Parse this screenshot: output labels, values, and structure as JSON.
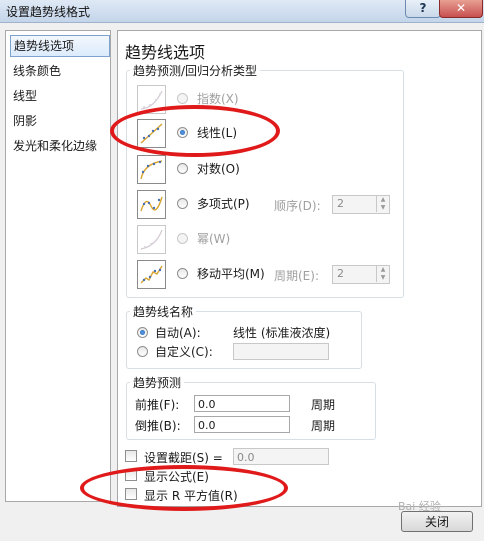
{
  "window": {
    "title": "设置趋势线格式",
    "help_glyph": "?",
    "close_glyph": "✕"
  },
  "nav": {
    "items": [
      {
        "label": "趋势线选项"
      },
      {
        "label": "线条颜色"
      },
      {
        "label": "线型"
      },
      {
        "label": "阴影"
      },
      {
        "label": "发光和柔化边缘"
      }
    ]
  },
  "main": {
    "heading": "趋势线选项",
    "trend_group": {
      "legend": "趋势预测/回归分析类型",
      "options": [
        {
          "label": "指数(X)",
          "enabled": false,
          "selected": false,
          "icon": "exponential-icon"
        },
        {
          "label": "线性(L)",
          "enabled": true,
          "selected": true,
          "icon": "linear-icon"
        },
        {
          "label": "对数(O)",
          "enabled": true,
          "selected": false,
          "icon": "logarithmic-icon"
        },
        {
          "label": "多项式(P)",
          "enabled": true,
          "selected": false,
          "icon": "polynomial-icon"
        },
        {
          "label": "幂(W)",
          "enabled": false,
          "selected": false,
          "icon": "power-icon"
        },
        {
          "label": "移动平均(M)",
          "enabled": true,
          "selected": false,
          "icon": "moving-average-icon"
        }
      ],
      "order_label": "顺序(D):",
      "order_value": "2",
      "period_label": "周期(E):",
      "period_value": "2"
    },
    "name_group": {
      "legend": "趋势线名称",
      "auto_label": "自动(A):",
      "auto_value": "线性 (标准液浓度)",
      "custom_label": "自定义(C):",
      "custom_value": ""
    },
    "forecast_group": {
      "legend": "趋势预测",
      "forward_label": "前推(F):",
      "forward_value": "0.0",
      "forward_unit": "周期",
      "backward_label": "倒推(B):",
      "backward_value": "0.0",
      "backward_unit": "周期"
    },
    "intercept": {
      "label": "设置截距(S) =",
      "value": "0.0",
      "checked": false
    },
    "show_equation": {
      "label": "显示公式(E)",
      "checked": false
    },
    "show_r2": {
      "label": "显示 R 平方值(R)",
      "checked": false
    }
  },
  "footer": {
    "close_label": "关闭"
  },
  "annotations": {
    "color": "#e01a1a"
  },
  "watermark": {
    "text": "Bai 经验"
  }
}
